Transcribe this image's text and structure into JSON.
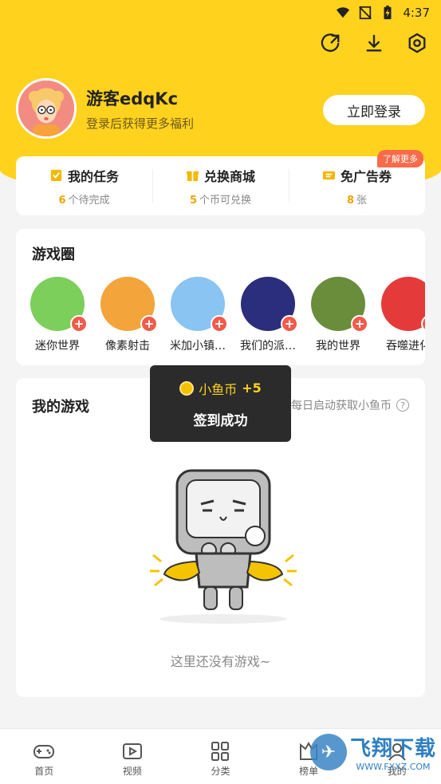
{
  "status_bar": {
    "time": "4:37"
  },
  "profile": {
    "username": "游客edqKc",
    "subtitle": "登录后获得更多福利",
    "login_label": "立即登录"
  },
  "stats": [
    {
      "title": "我的任务",
      "count": "6",
      "suffix": "个待完成",
      "icon": "task-icon",
      "color": "#f5b800"
    },
    {
      "title": "兑换商城",
      "count": "5",
      "suffix": "个币可兑换",
      "icon": "gift-icon",
      "color": "#f5b800"
    },
    {
      "title": "免广告券",
      "count": "8",
      "suffix": "张",
      "icon": "ticket-icon",
      "color": "#f5b800",
      "badge": "了解更多"
    }
  ],
  "game_circle": {
    "title": "游戏圈",
    "games": [
      {
        "name": "迷你世界",
        "color": "#7ccf5a"
      },
      {
        "name": "像素射击",
        "color": "#f3a43b"
      },
      {
        "name": "米加小镇…",
        "color": "#8ac4f2"
      },
      {
        "name": "我们的派…",
        "color": "#2a2e7c"
      },
      {
        "name": "我的世界",
        "color": "#6a8d3c"
      },
      {
        "name": "吞噬进化",
        "color": "#e53a3a"
      }
    ]
  },
  "my_games": {
    "title": "我的游戏",
    "hint": "每日启动获取小鱼币",
    "empty": "这里还没有游戏~"
  },
  "toast": {
    "coin_label": "小鱼币",
    "amount": "+5",
    "message": "签到成功"
  },
  "bottom_nav": [
    {
      "label": "首页",
      "icon": "gamepad-icon"
    },
    {
      "label": "视频",
      "icon": "video-icon"
    },
    {
      "label": "分类",
      "icon": "grid-icon"
    },
    {
      "label": "榜单",
      "icon": "rank-icon"
    },
    {
      "label": "我的",
      "icon": "user-icon"
    }
  ],
  "watermark": {
    "title": "飞翔下载",
    "url": "WWW.FXXZ.COM"
  },
  "colors": {
    "brand_yellow": "#ffd21e",
    "badge_red": "#f76b4a",
    "plus_red": "#f25a4a"
  }
}
